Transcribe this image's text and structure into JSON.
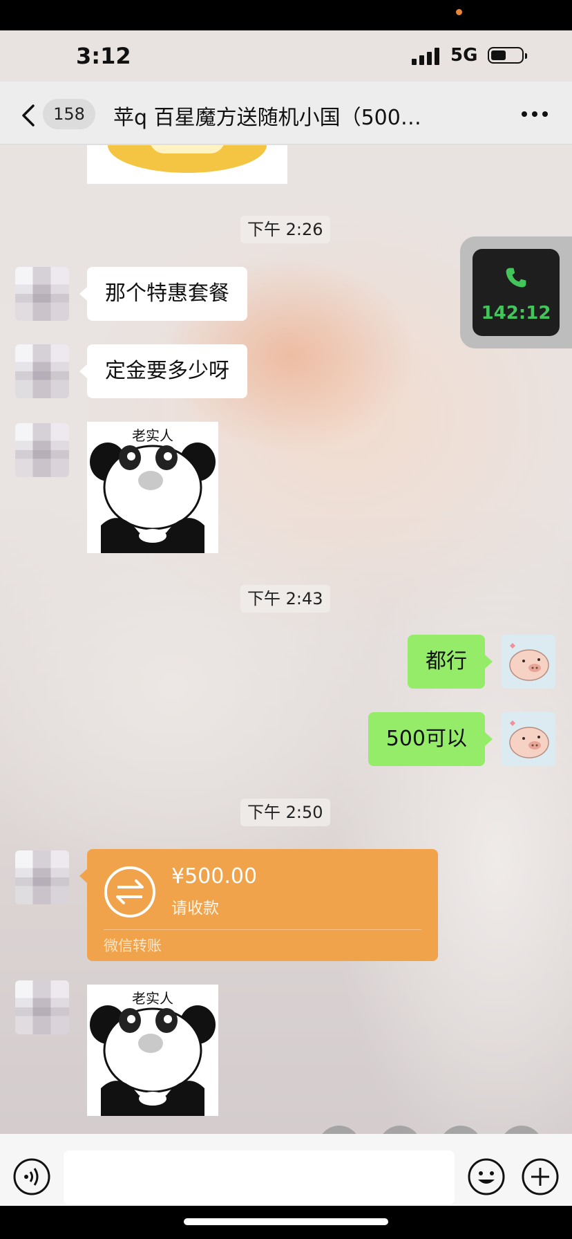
{
  "status_bar": {
    "time": "3:12",
    "network": "5G",
    "battery_level": 0.55
  },
  "nav": {
    "back_count": "158",
    "title": "苹q 百星魔方送随机小国（500…"
  },
  "call_widget": {
    "duration": "142:12"
  },
  "timestamps": [
    "下午 2:26",
    "下午 2:43",
    "下午 2:50"
  ],
  "messages": {
    "m1": "那个特惠套餐",
    "m2": "定金要多少呀",
    "m3": "都行",
    "m4": "500可以"
  },
  "stickers": {
    "caption": "老实人"
  },
  "transfer": {
    "amount": "¥500.00",
    "status": "请收款",
    "label": "微信转账"
  },
  "colors": {
    "nav_bg": "#ededed",
    "outgoing_bubble": "#95ec69",
    "incoming_bubble": "#ffffff",
    "transfer": "#f0a34a",
    "call_text": "#43c55c"
  }
}
